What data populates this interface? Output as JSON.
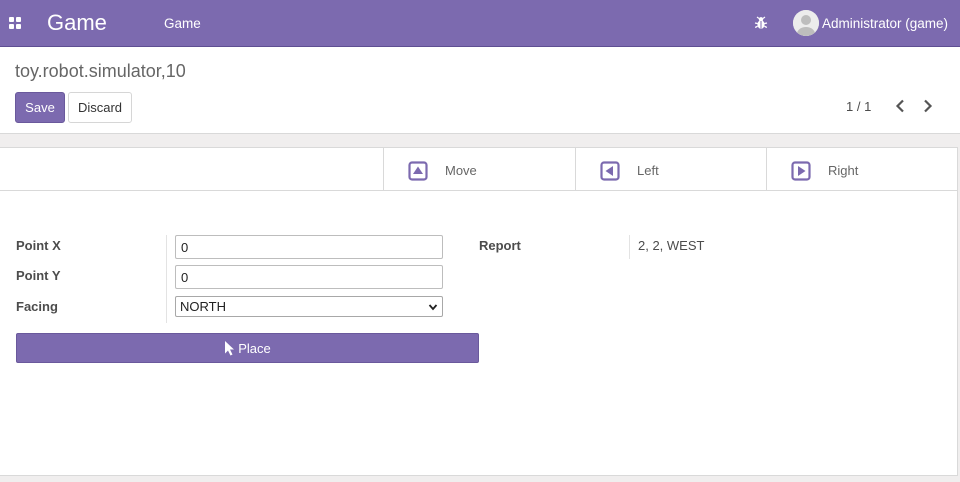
{
  "navbar": {
    "app_title": "Game",
    "menu_item": "Game",
    "user_name": "Administrator (game)",
    "icons": [
      "apps-icon",
      "bug-icon",
      "avatar"
    ],
    "color": "#7c6aaf"
  },
  "control_panel": {
    "breadcrumb": "toy.robot.simulator,10",
    "save_label": "Save",
    "discard_label": "Discard",
    "pager": "1 / 1"
  },
  "button_box": {
    "move_label": "Move",
    "left_label": "Left",
    "right_label": "Right"
  },
  "form": {
    "point_x_label": "Point X",
    "point_x_value": "0",
    "point_y_label": "Point Y",
    "point_y_value": "0",
    "facing_label": "Facing",
    "facing_value": "NORTH",
    "place_label": "Place",
    "report_label": "Report",
    "report_value": "2, 2, WEST"
  }
}
